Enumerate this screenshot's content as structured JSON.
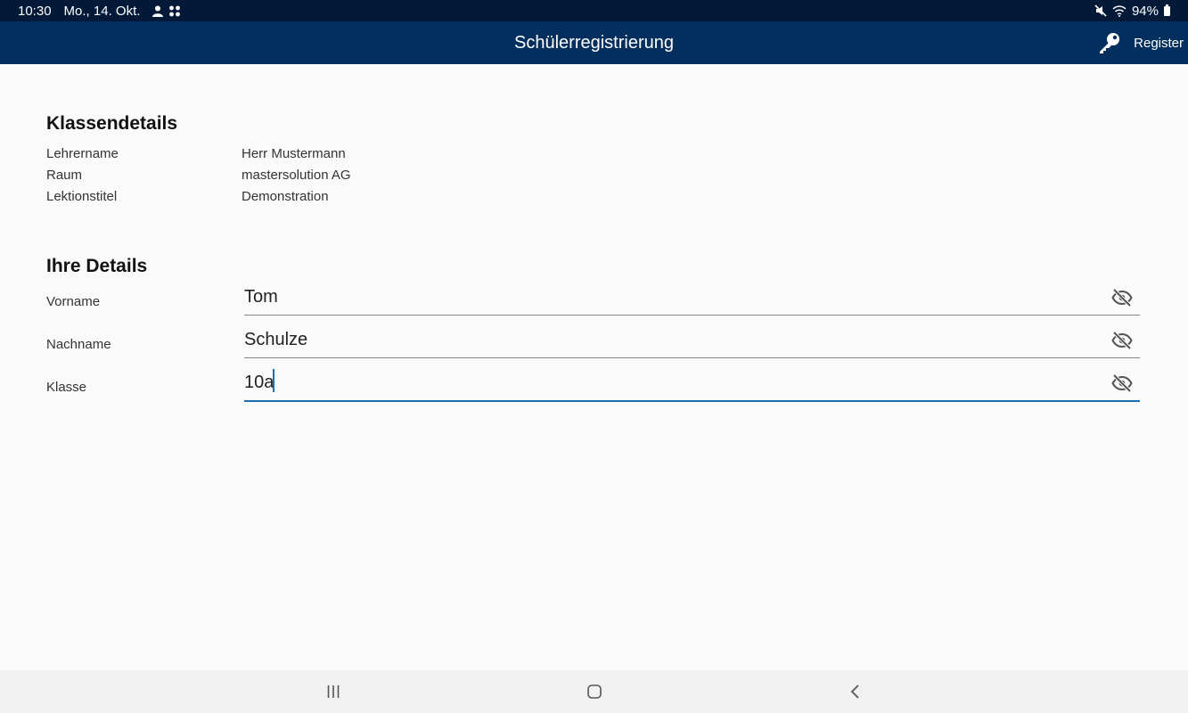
{
  "status_bar": {
    "time": "10:30",
    "date": "Mo., 14. Okt.",
    "battery": "94%"
  },
  "app_bar": {
    "title": "Schülerregistrierung",
    "register_label": "Register",
    "background": "#032f5e"
  },
  "class_details": {
    "title": "Klassendetails",
    "rows": [
      {
        "label": "Lehrername",
        "value": "Herr Mustermann"
      },
      {
        "label": "Raum",
        "value": "mastersolution AG"
      },
      {
        "label": "Lektionstitel",
        "value": "Demonstration"
      }
    ]
  },
  "your_details": {
    "title": "Ihre Details",
    "fields": [
      {
        "label": "Vorname",
        "value": "Tom"
      },
      {
        "label": "Nachname",
        "value": "Schulze"
      },
      {
        "label": "Klasse",
        "value": "10a"
      }
    ]
  },
  "colors": {
    "accent": "#1f6fb0",
    "status_bar": "#021a38"
  },
  "icons": {
    "register": "key-icon",
    "field_toggle": "eye-off-icon",
    "nav_recents": "recents-icon",
    "nav_home": "home-icon",
    "nav_back": "back-icon"
  }
}
